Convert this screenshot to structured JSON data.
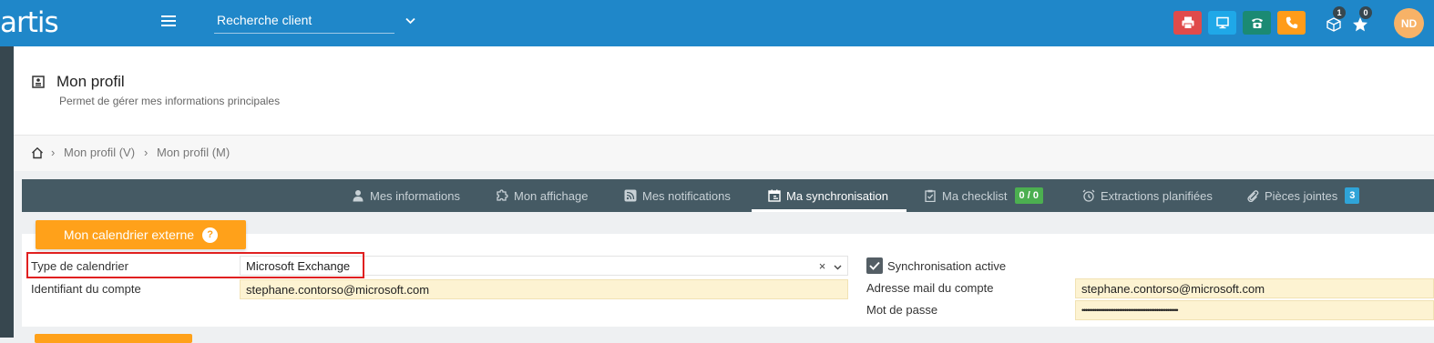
{
  "topbar": {
    "logo": "artis",
    "search": {
      "placeholder": "Recherche client"
    },
    "badges": {
      "cube": "1",
      "star": "0"
    },
    "avatar": "ND",
    "colors": {
      "print": "#e04b4b",
      "screen": "#1fa8e8",
      "phone": "#1b8a73",
      "call": "#ff9c1a"
    }
  },
  "header": {
    "title": "Mon profil",
    "subtitle": "Permet de gérer mes informations principales"
  },
  "breadcrumb": [
    "Mon profil (V)",
    "Mon profil (M)"
  ],
  "tabs": [
    {
      "label": "Mes informations",
      "icon": "user-icon"
    },
    {
      "label": "Mon affichage",
      "icon": "puzzle-icon"
    },
    {
      "label": "Mes notifications",
      "icon": "rss-icon"
    },
    {
      "label": "Ma synchronisation",
      "icon": "calendar-icon",
      "active": true
    },
    {
      "label": "Ma checklist",
      "icon": "clipboard-icon",
      "badge": "0 / 0",
      "badge_color": "#4caf50"
    },
    {
      "label": "Extractions planifiées",
      "icon": "alarm-icon"
    },
    {
      "label": "Pièces jointes",
      "icon": "paperclip-icon",
      "badge": "3",
      "badge_color": "#2fa4d8"
    }
  ],
  "section": {
    "title": "Mon calendrier externe",
    "help": "?"
  },
  "form": {
    "type_label": "Type de calendrier",
    "type_value": "Microsoft Exchange",
    "account_label": "Identifiant du compte",
    "account_value": "stephane.contorso@microsoft.com",
    "sync_label": "Synchronisation active",
    "mail_label": "Adresse mail du compte",
    "mail_value": "stephane.contorso@microsoft.com",
    "password_label": "Mot de passe",
    "password_value": "••••••••••••••••••••••••••••••••••••••••••••••••••••••"
  }
}
